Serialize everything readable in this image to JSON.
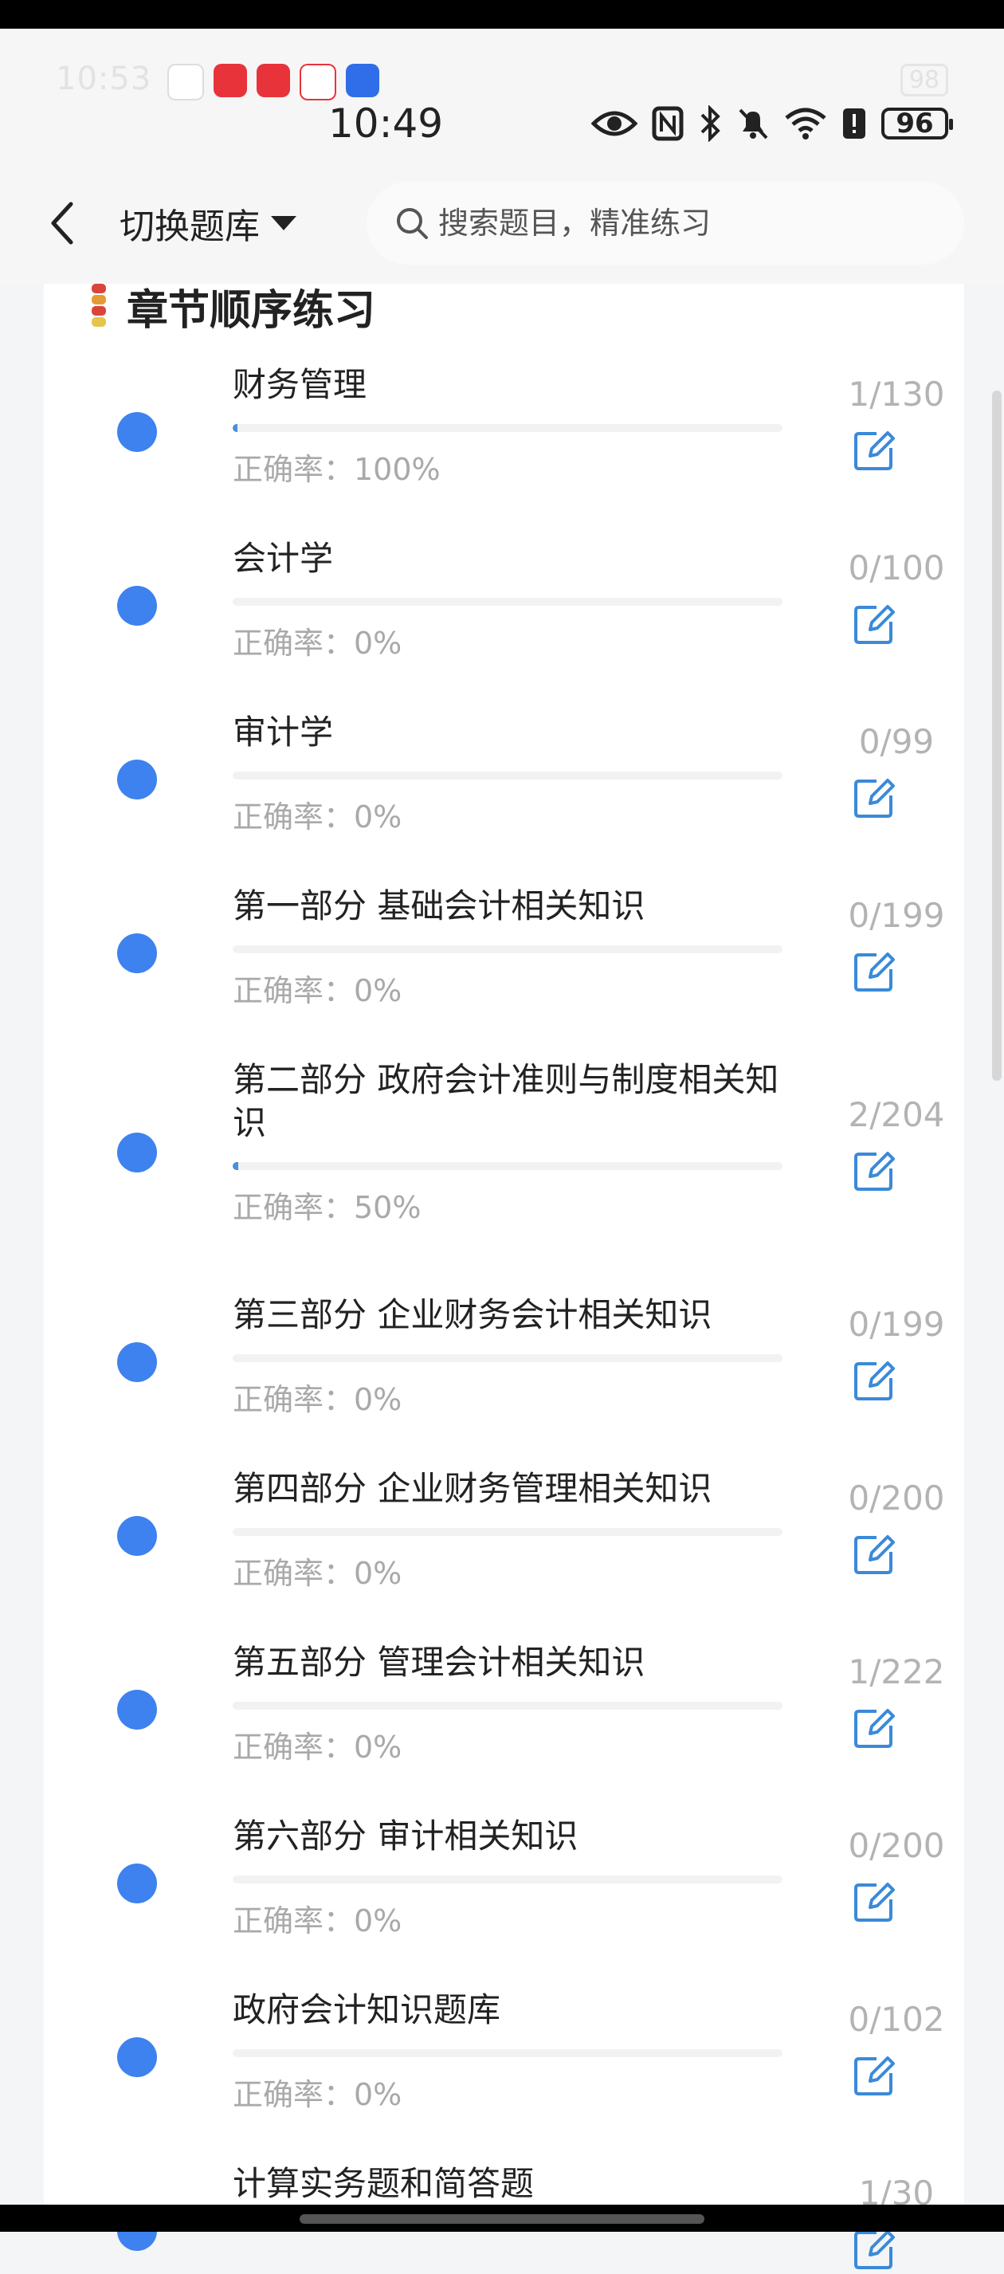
{
  "status": {
    "ghost_time": "10:53",
    "ghost_battery": "98",
    "time": "10:49",
    "battery": "96",
    "notif_colors": [
      "#ffffff",
      "#e8333b",
      "#e8333b",
      "#ffffff",
      "#2f6ee8"
    ]
  },
  "nav": {
    "switch_label": "切换题库",
    "search_placeholder": "搜索题目，精准练习"
  },
  "section": {
    "title": "章节顺序练习"
  },
  "chapters": [
    {
      "name": "财务管理",
      "accuracy": "正确率：100%",
      "count": "1/130",
      "progress": 0.0077
    },
    {
      "name": "会计学",
      "accuracy": "正确率：0%",
      "count": "0/100",
      "progress": 0
    },
    {
      "name": "审计学",
      "accuracy": "正确率：0%",
      "count": "0/99",
      "progress": 0
    },
    {
      "name": "第一部分 基础会计相关知识",
      "accuracy": "正确率：0%",
      "count": "0/199",
      "progress": 0
    },
    {
      "name": "第二部分 政府会计准则与制度相关知识",
      "accuracy": "正确率：50%",
      "count": "2/204",
      "progress": 0.0098
    },
    {
      "name": "第三部分 企业财务会计相关知识",
      "accuracy": "正确率：0%",
      "count": "0/199",
      "progress": 0
    },
    {
      "name": "第四部分 企业财务管理相关知识",
      "accuracy": "正确率：0%",
      "count": "0/200",
      "progress": 0
    },
    {
      "name": "第五部分 管理会计相关知识",
      "accuracy": "正确率：0%",
      "count": "1/222",
      "progress": 0
    },
    {
      "name": "第六部分 审计相关知识",
      "accuracy": "正确率：0%",
      "count": "0/200",
      "progress": 0
    },
    {
      "name": "政府会计知识题库",
      "accuracy": "正确率：0%",
      "count": "0/102",
      "progress": 0
    },
    {
      "name": "计算实务题和简答题",
      "accuracy": "",
      "count": "1/30",
      "progress": 0
    }
  ],
  "colors": {
    "accent": "#3d82ef",
    "edit_icon": "#3a8ad8",
    "muted_text": "#a9a9a9"
  },
  "icons": {
    "back": "chevron-left-icon",
    "search": "search-icon",
    "section": "firecracker-icon",
    "edit": "edit-icon"
  }
}
